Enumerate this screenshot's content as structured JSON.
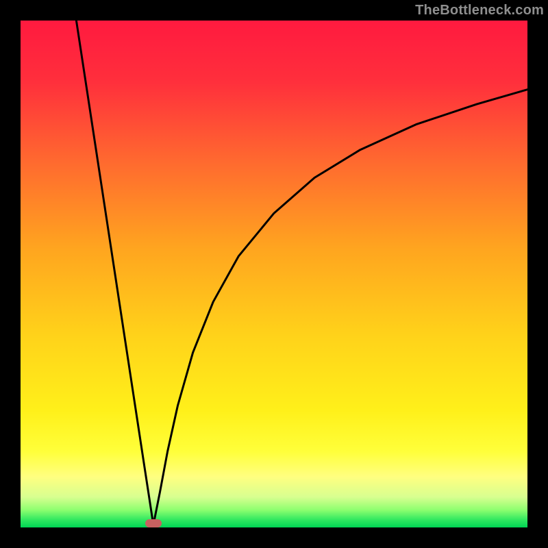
{
  "watermark": "TheBottleneck.com",
  "chart_data": {
    "type": "line",
    "title": "",
    "xlabel": "",
    "ylabel": "",
    "xlim": [
      0,
      100
    ],
    "ylim": [
      0,
      100
    ],
    "gradient_stops": [
      {
        "pos": 0.0,
        "color": "#ff1a3f"
      },
      {
        "pos": 0.12,
        "color": "#ff2f3c"
      },
      {
        "pos": 0.28,
        "color": "#ff6a2f"
      },
      {
        "pos": 0.45,
        "color": "#ffa51f"
      },
      {
        "pos": 0.62,
        "color": "#ffd21a"
      },
      {
        "pos": 0.77,
        "color": "#fff01a"
      },
      {
        "pos": 0.85,
        "color": "#ffff3a"
      },
      {
        "pos": 0.9,
        "color": "#ffff80"
      },
      {
        "pos": 0.94,
        "color": "#d8ff90"
      },
      {
        "pos": 0.965,
        "color": "#8fff70"
      },
      {
        "pos": 0.985,
        "color": "#30e860"
      },
      {
        "pos": 1.0,
        "color": "#00d455"
      }
    ],
    "series": [
      {
        "name": "left-branch",
        "x": [
          11.0,
          13.0,
          15.0,
          17.0,
          19.0,
          21.0,
          23.0,
          24.5,
          25.5,
          26.2
        ],
        "y": [
          100.0,
          86.9,
          73.8,
          60.7,
          47.6,
          34.5,
          21.4,
          11.6,
          5.1,
          0.5
        ]
      },
      {
        "name": "right-branch",
        "x": [
          26.2,
          27.5,
          29.0,
          31.0,
          34.0,
          38.0,
          43.0,
          50.0,
          58.0,
          67.0,
          78.0,
          90.0,
          100.0
        ],
        "y": [
          0.5,
          7.0,
          15.0,
          24.0,
          34.5,
          44.5,
          53.5,
          62.0,
          69.0,
          74.5,
          79.5,
          83.5,
          86.4
        ]
      }
    ],
    "marker": {
      "x": 26.2,
      "y": 0.8,
      "color": "#c76160"
    }
  }
}
